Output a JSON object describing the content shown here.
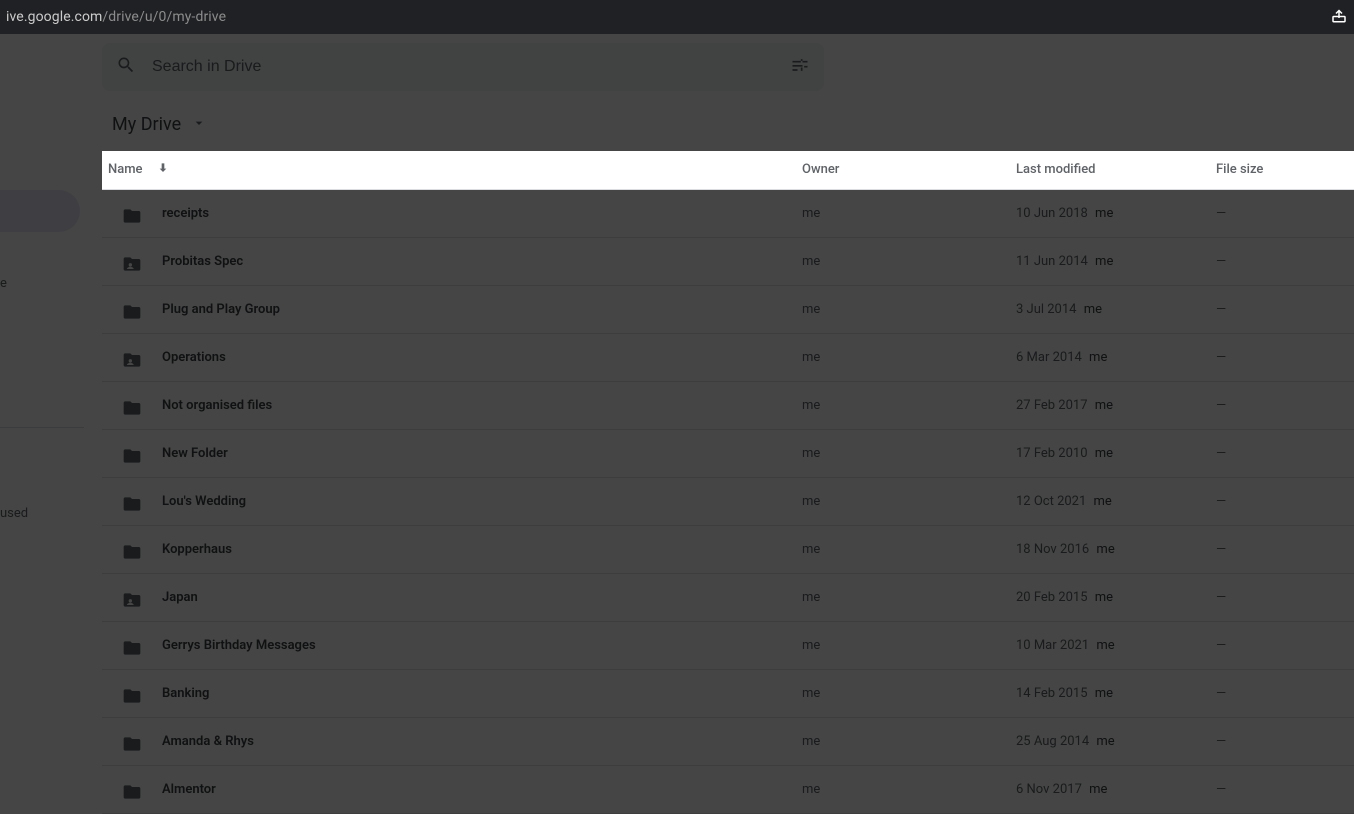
{
  "url": {
    "host_prefix": "ive.google.com",
    "path": "/drive/u/0/my-drive"
  },
  "search": {
    "placeholder": "Search in Drive"
  },
  "breadcrumb": {
    "title": "My Drive"
  },
  "sidebar": {
    "item_label_partial": "e",
    "storage_partial": "used"
  },
  "columns": {
    "name": "Name",
    "owner": "Owner",
    "modified": "Last modified",
    "size": "File size"
  },
  "rows": [
    {
      "name": "receipts",
      "owner": "me",
      "date": "10 Jun 2018",
      "by": "me",
      "size": "—",
      "shared": false
    },
    {
      "name": "Probitas Spec",
      "owner": "me",
      "date": "11 Jun 2014",
      "by": "me",
      "size": "—",
      "shared": true
    },
    {
      "name": "Plug and Play Group",
      "owner": "me",
      "date": "3 Jul 2014",
      "by": "me",
      "size": "—",
      "shared": false
    },
    {
      "name": "Operations",
      "owner": "me",
      "date": "6 Mar 2014",
      "by": "me",
      "size": "—",
      "shared": true
    },
    {
      "name": "Not organised files",
      "owner": "me",
      "date": "27 Feb 2017",
      "by": "me",
      "size": "—",
      "shared": false
    },
    {
      "name": "New Folder",
      "owner": "me",
      "date": "17 Feb 2010",
      "by": "me",
      "size": "—",
      "shared": false
    },
    {
      "name": "Lou's Wedding",
      "owner": "me",
      "date": "12 Oct 2021",
      "by": "me",
      "size": "—",
      "shared": false
    },
    {
      "name": "Kopperhaus",
      "owner": "me",
      "date": "18 Nov 2016",
      "by": "me",
      "size": "—",
      "shared": false
    },
    {
      "name": "Japan",
      "owner": "me",
      "date": "20 Feb 2015",
      "by": "me",
      "size": "—",
      "shared": true
    },
    {
      "name": "Gerrys Birthday Messages",
      "owner": "me",
      "date": "10 Mar 2021",
      "by": "me",
      "size": "—",
      "shared": false
    },
    {
      "name": "Banking",
      "owner": "me",
      "date": "14 Feb 2015",
      "by": "me",
      "size": "—",
      "shared": false
    },
    {
      "name": "Amanda & Rhys",
      "owner": "me",
      "date": "25 Aug 2014",
      "by": "me",
      "size": "—",
      "shared": false
    },
    {
      "name": "Almentor",
      "owner": "me",
      "date": "6 Nov 2017",
      "by": "me",
      "size": "—",
      "shared": false
    }
  ]
}
